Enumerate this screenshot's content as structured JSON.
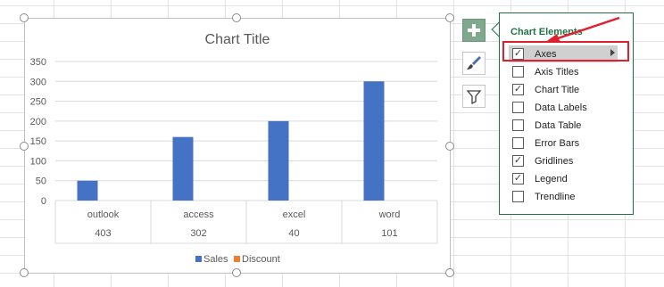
{
  "colors": {
    "sales": "#4472c4",
    "discount": "#ed7d31",
    "accent_green": "#217346",
    "annotation_red": "#e0202e"
  },
  "chart_data": {
    "type": "bar",
    "title": "Chart Title",
    "categories": [
      "outlook",
      "access",
      "excel",
      "word"
    ],
    "secondary_categories": [
      "403",
      "302",
      "40",
      "101"
    ],
    "series": [
      {
        "name": "Sales",
        "values": [
          50,
          160,
          200,
          300
        ]
      },
      {
        "name": "Discount",
        "values": [
          0,
          0,
          0,
          0
        ]
      }
    ],
    "ylim": [
      0,
      350
    ],
    "yticks": [
      "0",
      "50",
      "100",
      "150",
      "200",
      "250",
      "300",
      "350"
    ],
    "grid": true,
    "legend": "bottom"
  },
  "side_buttons": {
    "elements_icon": "plus-icon",
    "styles_icon": "paintbrush-icon",
    "filters_icon": "funnel-icon"
  },
  "panel": {
    "title": "Chart Elements",
    "items": [
      {
        "label": "Axes",
        "checked": true
      },
      {
        "label": "Axis Titles",
        "checked": false
      },
      {
        "label": "Chart Title",
        "checked": true
      },
      {
        "label": "Data Labels",
        "checked": false
      },
      {
        "label": "Data Table",
        "checked": false
      },
      {
        "label": "Error Bars",
        "checked": false
      },
      {
        "label": "Gridlines",
        "checked": true
      },
      {
        "label": "Legend",
        "checked": true
      },
      {
        "label": "Trendline",
        "checked": false
      }
    ]
  }
}
